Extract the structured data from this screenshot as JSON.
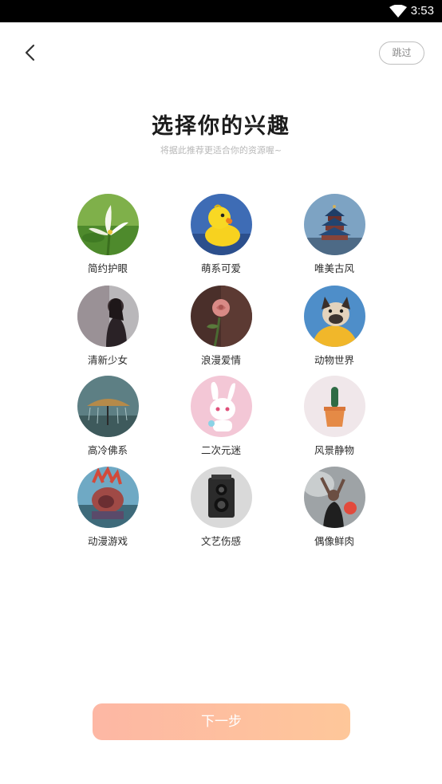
{
  "status_bar": {
    "time": "3:53"
  },
  "header": {
    "skip_label": "跳过"
  },
  "title": "选择你的兴趣",
  "subtitle": "将据此推荐更适合你的资源喔~",
  "interests": [
    {
      "label": "简约护眼",
      "icon": "lily-flower-image"
    },
    {
      "label": "萌系可爱",
      "icon": "rubber-duck-image"
    },
    {
      "label": "唯美古风",
      "icon": "temple-of-heaven-image"
    },
    {
      "label": "清新少女",
      "icon": "girl-silhouette-image"
    },
    {
      "label": "浪漫爱情",
      "icon": "rose-image"
    },
    {
      "label": "动物世界",
      "icon": "bulldog-image"
    },
    {
      "label": "高冷佛系",
      "icon": "umbrella-rain-image"
    },
    {
      "label": "二次元迷",
      "icon": "pink-bunny-image"
    },
    {
      "label": "风景静物",
      "icon": "cactus-pot-image"
    },
    {
      "label": "动漫游戏",
      "icon": "game-character-image"
    },
    {
      "label": "文艺伤感",
      "icon": "vintage-camera-image"
    },
    {
      "label": "偶像鲜肉",
      "icon": "idol-performer-image"
    }
  ],
  "next_label": "下一步",
  "colors": {
    "button_gradient_start": "#fdb7a4",
    "button_gradient_end": "#fec79a",
    "status_bar": "#000000"
  }
}
